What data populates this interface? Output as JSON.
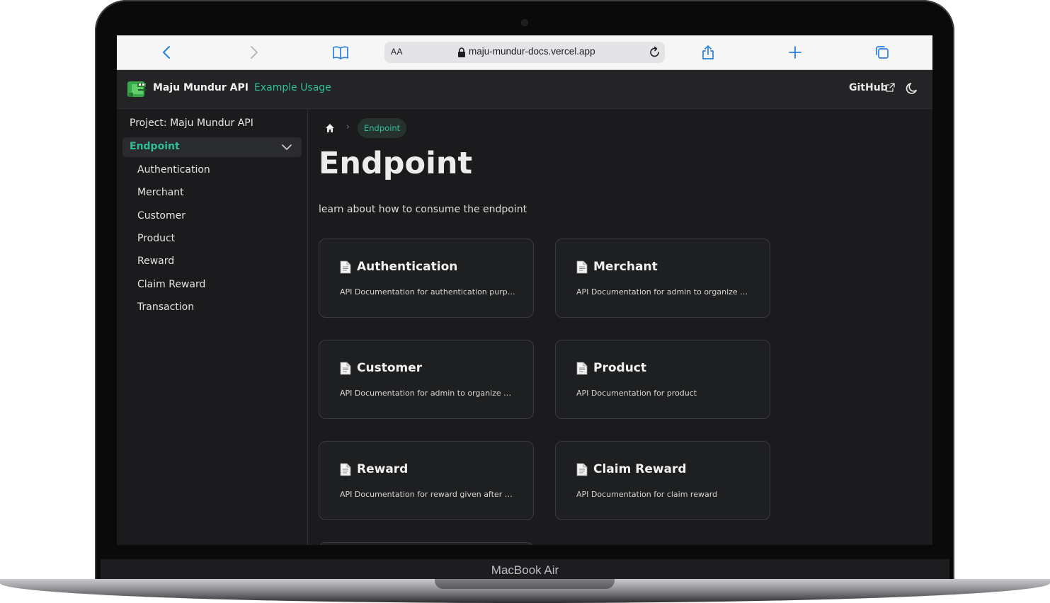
{
  "device": {
    "label": "MacBook Air"
  },
  "browser": {
    "url": "maju-mundur-docs.vercel.app",
    "reader_label": "AA"
  },
  "site": {
    "brand": "Maju Mundur API",
    "nav_link": "Example Usage",
    "github_label": "GitHub"
  },
  "sidebar": {
    "project": "Project: Maju Mundur API",
    "section": "Endpoint",
    "items": [
      "Authentication",
      "Merchant",
      "Customer",
      "Product",
      "Reward",
      "Claim Reward",
      "Transaction"
    ]
  },
  "breadcrumb": {
    "current": "Endpoint"
  },
  "page": {
    "title": "Endpoint",
    "description": "learn about how to consume the endpoint"
  },
  "cards": [
    {
      "title": "Authentication",
      "description": "API Documentation for authentication purpose"
    },
    {
      "title": "Merchant",
      "description": "API Documentation for admin to organize m..."
    },
    {
      "title": "Customer",
      "description": "API Documentation for admin to organize cu..."
    },
    {
      "title": "Product",
      "description": "API Documentation for product"
    },
    {
      "title": "Reward",
      "description": "API Documentation for reward given after tr..."
    },
    {
      "title": "Claim Reward",
      "description": "API Documentation for claim reward"
    }
  ],
  "colors": {
    "accent": "#2fbf99",
    "background": "#1b1b1d",
    "card_border": "#3a3b3e"
  },
  "icons": [
    "back-icon",
    "forward-icon",
    "bookmarks-icon",
    "lock-icon",
    "reload-icon",
    "share-icon",
    "new-tab-icon",
    "tabs-icon",
    "external-link-icon",
    "moon-icon",
    "chevron-down-icon",
    "home-icon",
    "document-icon"
  ]
}
